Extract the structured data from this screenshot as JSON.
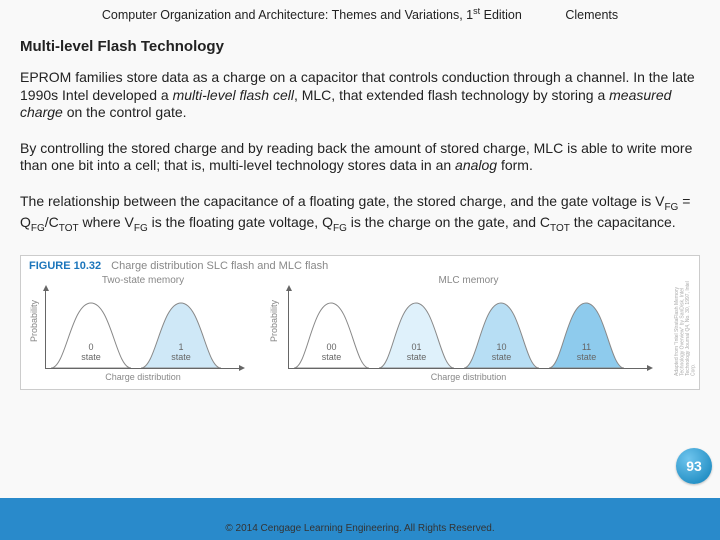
{
  "header": {
    "book": "Computer Organization and Architecture: Themes and Variations, 1",
    "edition_sup": "st",
    "edition_tail": " Edition",
    "author": "Clements"
  },
  "section_title": "Multi-level Flash Technology",
  "p1": {
    "a": "EPROM families store data as a charge on a capacitor that controls conduction through a channel.  In the late 1990s Intel developed a ",
    "b": "multi-level flash cell",
    "c": ", MLC, that extended flash technology by storing a ",
    "d": "measured charge",
    "e": " on the control gate."
  },
  "p2": {
    "a": "By controlling the stored charge and by reading back the amount of stored charge, MLC is able to write more than one bit into a cell; that is, multi-level technology stores data in an ",
    "b": "analog",
    "c": " form."
  },
  "p3": {
    "a": "The relationship between the capacitance of a floating gate, the stored charge, and the gate voltage is V",
    "s1": "FG",
    "b": " = Q",
    "s2": "FG",
    "c": "/C",
    "s3": "TOT",
    "d": " where V",
    "s4": "FG",
    "e": " is the floating gate voltage, Q",
    "s5": "FG",
    "f": " is the charge on the gate, and C",
    "s6": "TOT",
    "g": " the capacitance."
  },
  "figure": {
    "num": "FIGURE 10.32",
    "caption": "Charge distribution SLC flash and MLC flash",
    "ylabel": "Probability",
    "xlabel": "Charge distribution",
    "slc": {
      "title": "Two-state memory",
      "states": [
        {
          "top": "0",
          "bot": "state"
        },
        {
          "top": "1",
          "bot": "state"
        }
      ]
    },
    "mlc": {
      "title": "MLC memory",
      "states": [
        {
          "top": "00",
          "bot": "state"
        },
        {
          "top": "01",
          "bot": "state"
        },
        {
          "top": "10",
          "bot": "state"
        },
        {
          "top": "11",
          "bot": "state"
        }
      ]
    },
    "credit": "Adapted from \"Intel StrataFlash Memory Technology Overview\" by SanDisk, Intel Technology Journal Q4, No. 30, 1997, Intel Corp."
  },
  "chart_data": {
    "type": "distribution",
    "panels": [
      {
        "name": "Two-state memory",
        "xlabel": "Charge distribution",
        "ylabel": "Probability",
        "states": [
          "0",
          "1"
        ],
        "shading": [
          "none",
          "light-blue"
        ]
      },
      {
        "name": "MLC memory",
        "xlabel": "Charge distribution",
        "ylabel": "Probability",
        "states": [
          "00",
          "01",
          "10",
          "11"
        ],
        "shading": [
          "none",
          "very-light-blue",
          "light-blue",
          "blue"
        ]
      }
    ]
  },
  "page_number": "93",
  "copyright": "© 2014 Cengage Learning Engineering. All Rights Reserved."
}
